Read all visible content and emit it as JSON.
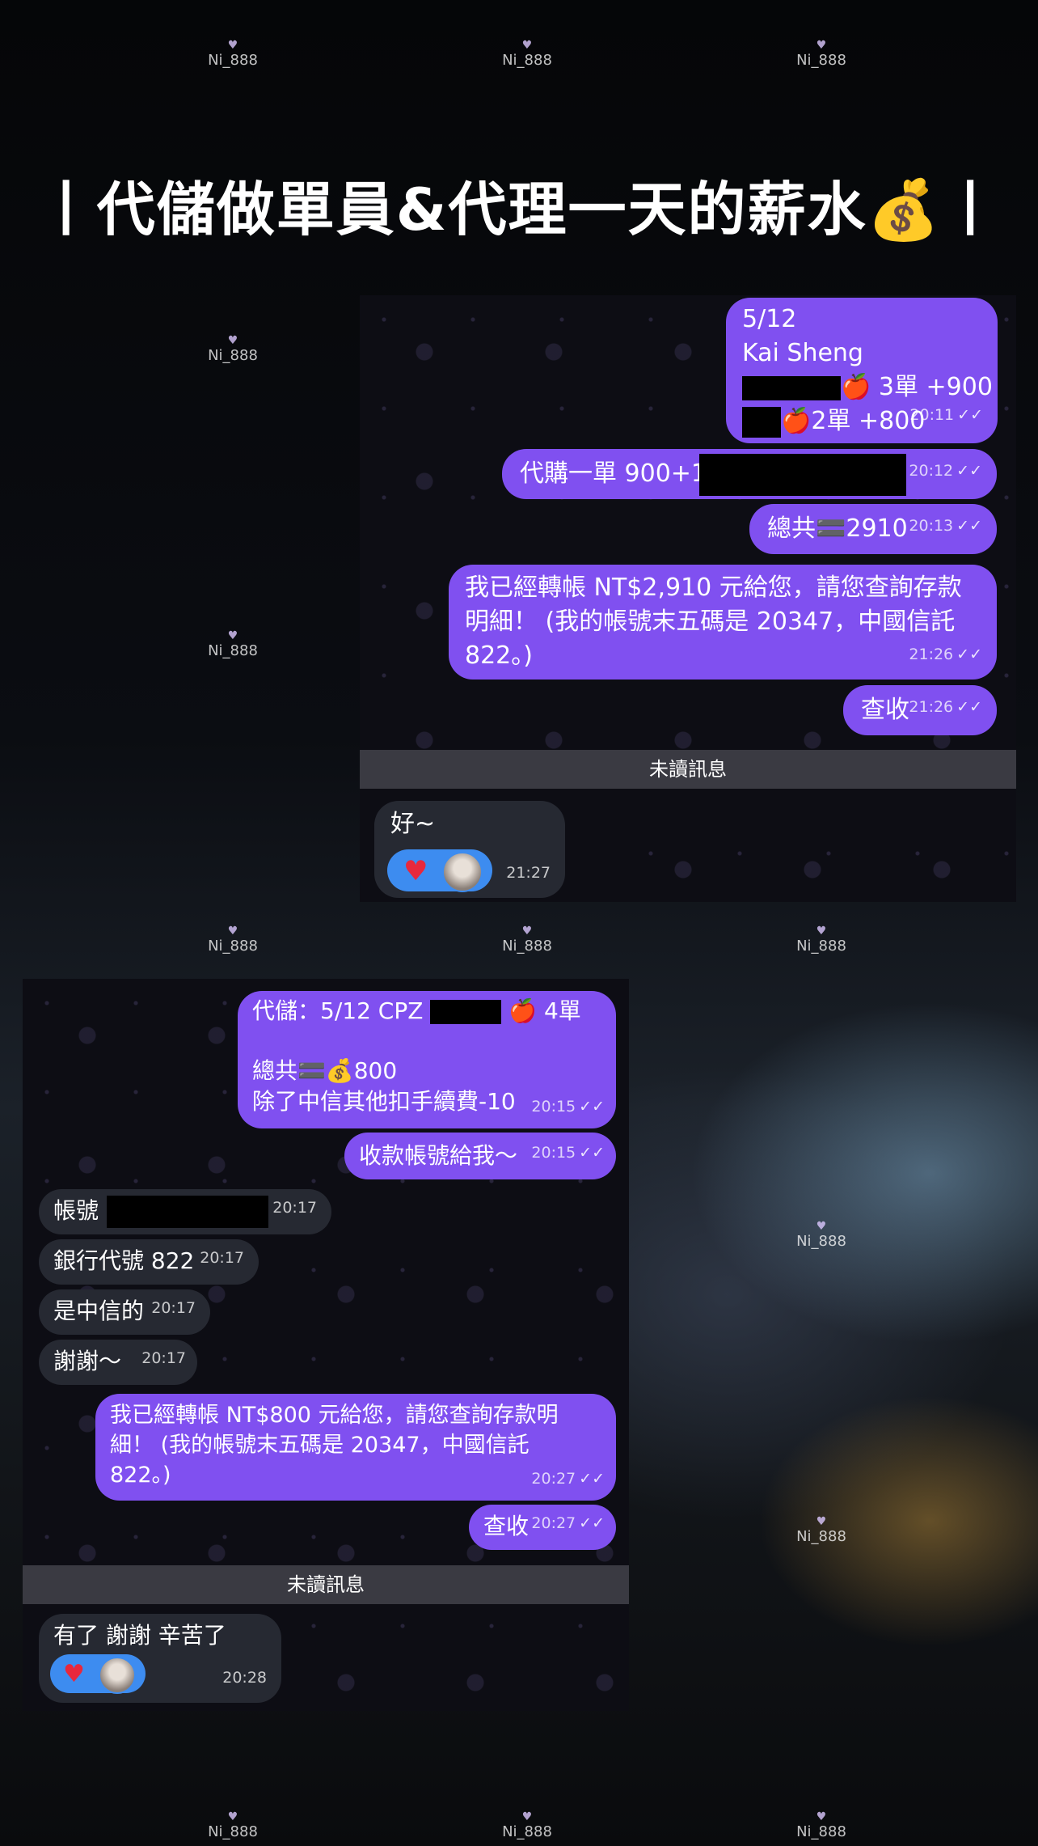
{
  "title": "丨代儲做單員&代理一天的薪水💰丨",
  "watermark": "Ni_888",
  "chat1": {
    "msg1": {
      "line1": "5/12",
      "line2": "Kai Sheng",
      "line3_suffix": "🍎 3單 +900",
      "line4_suffix": "🍎2單 +800",
      "time": "20:11"
    },
    "msg2": {
      "text": "代購一單 900+1",
      "time": "20:12"
    },
    "msg3": {
      "text": "總共🟰2910",
      "time": "20:13"
    },
    "msg4": {
      "line1": "我已經轉帳 NT$2,910 元給您，請您查詢存款",
      "line2": "明細！ (我的帳號末五碼是 20347，中國信託",
      "line3": "822。)",
      "time": "21:26"
    },
    "msg5": {
      "text": "查收",
      "time": "21:26"
    },
    "unread_label": "未讀訊息",
    "reply": {
      "text": "好~",
      "time": "21:27"
    }
  },
  "chat2": {
    "msg1": {
      "line1_prefix": "代儲：5/12 CPZ",
      "line1_suffix": "🍎 4單",
      "line2": "總共🟰💰800",
      "line3": "除了中信其他扣手續費-10",
      "time": "20:15"
    },
    "msg2": {
      "text": "收款帳號給我～",
      "time": "20:15"
    },
    "in1": {
      "text": "帳號",
      "time": "20:17"
    },
    "in2": {
      "text": "銀行代號 822",
      "time": "20:17"
    },
    "in3": {
      "text": "是中信的",
      "time": "20:17"
    },
    "in4": {
      "text": "謝謝～",
      "time": "20:17"
    },
    "msg3": {
      "line1": "我已經轉帳 NT$800 元給您，請您查詢存款明",
      "line2": "細！ (我的帳號末五碼是 20347，中國信託",
      "line3": "822。)",
      "time": "20:27"
    },
    "msg4": {
      "text": "查收",
      "time": "20:27"
    },
    "unread_label": "未讀訊息",
    "reply": {
      "text": "有了 謝謝 辛苦了 ~~",
      "time": "20:28"
    }
  },
  "colors": {
    "outgoing_bubble": "#8050f0",
    "incoming_bubble": "#262932",
    "reaction": "#3d8cf0"
  },
  "icons": [
    "heart-icon",
    "double-check-icon",
    "avatar",
    "money-bag-icon",
    "apple-icon"
  ]
}
